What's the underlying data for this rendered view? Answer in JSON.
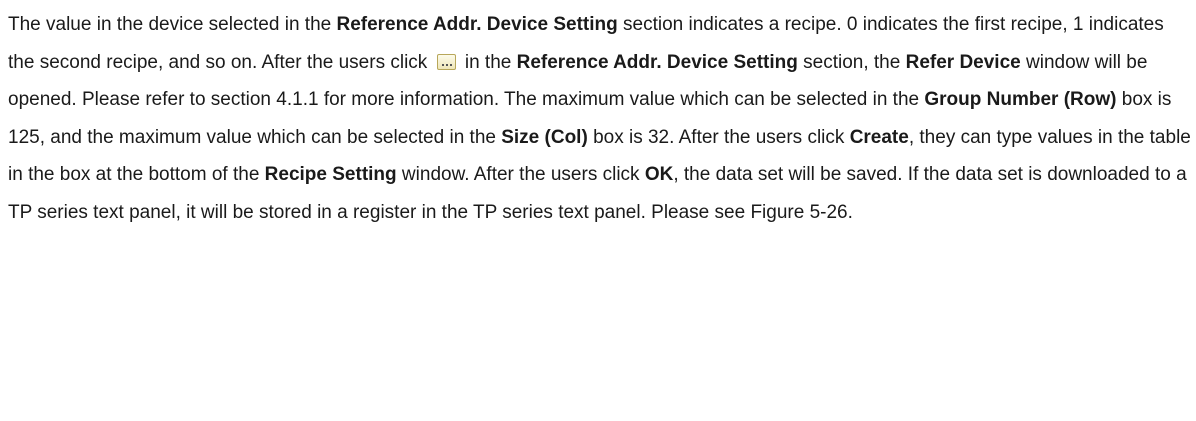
{
  "text": {
    "s1a": "The value in the device selected in the ",
    "s1b": "Reference Addr. Device Setting",
    "s1c": " section indicates a recipe. 0 indicates the first recipe, 1 indicates the second recipe, and so on. After the users click ",
    "s2a": " in the ",
    "s2b": "Reference Addr. Device Setting",
    "s2c": " section, the ",
    "s2d": "Refer Device",
    "s2e": " window will be opened. Please refer to section 4.1.1 for more information. The maximum value which can be selected in the ",
    "s3a": "Group Number (Row)",
    "s3b": " box is 125, and the maximum value which can be selected in the ",
    "s3c": "Size (Col)",
    "s3d": " box is 32. After the users click ",
    "s3e": "Create",
    "s3f": ", they can type values in the table in the box at the bottom of the ",
    "s3g": "Recipe Setting",
    "s3h": " window. After the users click ",
    "s3i": "OK",
    "s3j": ", the data set will be saved. If the data set is downloaded to a TP series text panel, it will be stored in a register in the TP series text panel. Please see Figure 5-26."
  },
  "icons": {
    "inline_button": "ellipsis-button-icon"
  }
}
